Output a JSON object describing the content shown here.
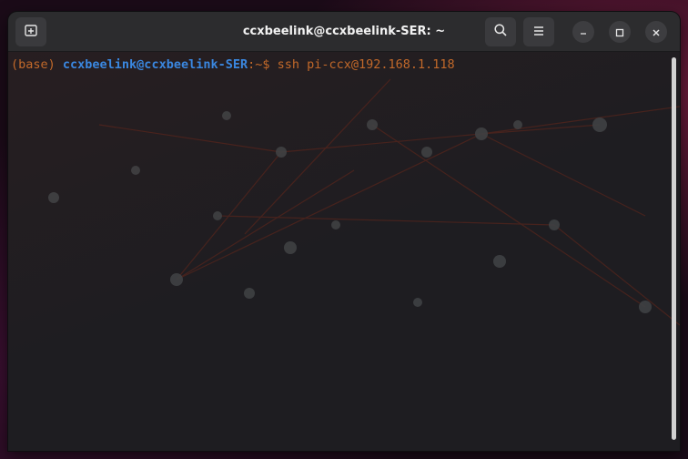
{
  "window": {
    "title": "ccxbeelink@ccxbeelink-SER: ~"
  },
  "titlebar": {
    "new_tab_icon": "new-tab-icon",
    "search_icon": "search-icon",
    "menu_icon": "hamburger-menu-icon",
    "minimize_icon": "minimize-icon",
    "maximize_icon": "maximize-icon",
    "close_icon": "close-icon"
  },
  "terminal": {
    "prompt_env": "(base) ",
    "prompt_user_host": "ccxbeelink@ccxbeelink-SER",
    "prompt_path": ":~$ ",
    "command": "ssh pi-ccx@192.168.1.118"
  },
  "colors": {
    "env": "#c2692a",
    "user_host": "#3a87e0",
    "command": "#c2692a"
  }
}
